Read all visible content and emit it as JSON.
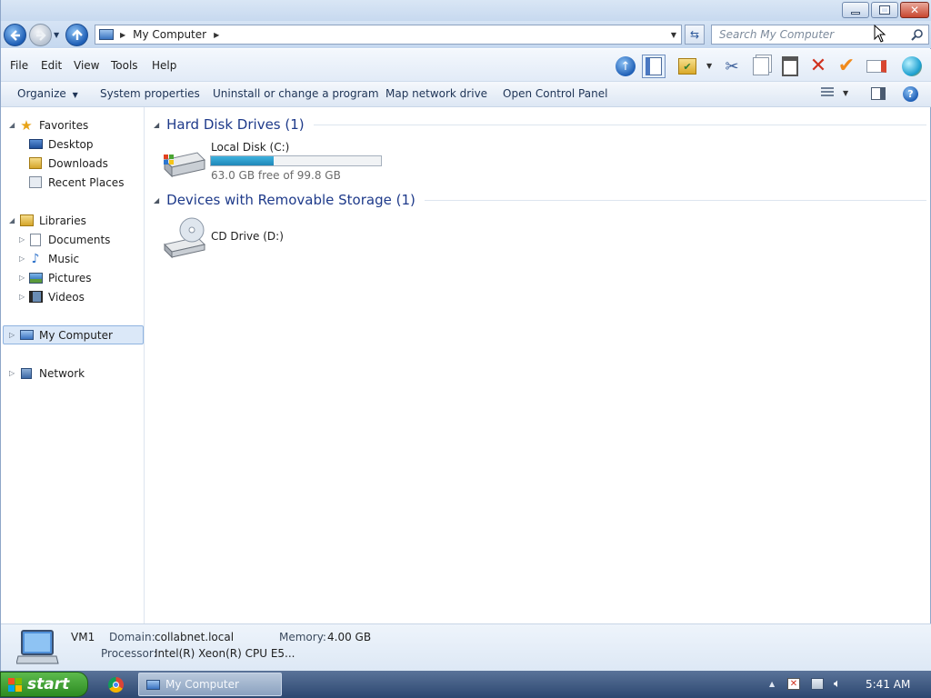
{
  "window": {
    "minimize_icon": "minimize-icon",
    "maximize_icon": "restore-icon",
    "close_icon": "close-icon"
  },
  "address_bar": {
    "path": "My Computer",
    "search_placeholder": "Search My Computer"
  },
  "menu": {
    "items": [
      "File",
      "Edit",
      "View",
      "Tools",
      "Help"
    ]
  },
  "command_bar": {
    "organize": "Organize",
    "system_properties": "System properties",
    "uninstall": "Uninstall or change a program",
    "map_drive": "Map network drive",
    "control_panel": "Open Control Panel"
  },
  "nav": {
    "favorites": "Favorites",
    "desktop": "Desktop",
    "downloads": "Downloads",
    "recent_places": "Recent Places",
    "libraries": "Libraries",
    "documents": "Documents",
    "music": "Music",
    "pictures": "Pictures",
    "videos": "Videos",
    "my_computer": "My Computer",
    "network": "Network"
  },
  "content": {
    "hdd_group": "Hard Disk Drives (1)",
    "local_disk_name": "Local Disk (C:)",
    "local_disk_free": "63.0 GB free of 99.8 GB",
    "local_disk_used_fraction": 0.369,
    "removable_group": "Devices with Removable Storage (1)",
    "cd_drive_name": "CD Drive (D:)"
  },
  "details": {
    "computer_name": "VM1",
    "domain_label": "Domain:",
    "domain_value": "collabnet.local",
    "memory_label": "Memory:",
    "memory_value": "4.00 GB",
    "processor_label": "Processor:",
    "processor_value": "Intel(R) Xeon(R) CPU E5..."
  },
  "taskbar": {
    "start_label": "start",
    "task_label": "My Computer",
    "clock": "5:41 AM"
  }
}
